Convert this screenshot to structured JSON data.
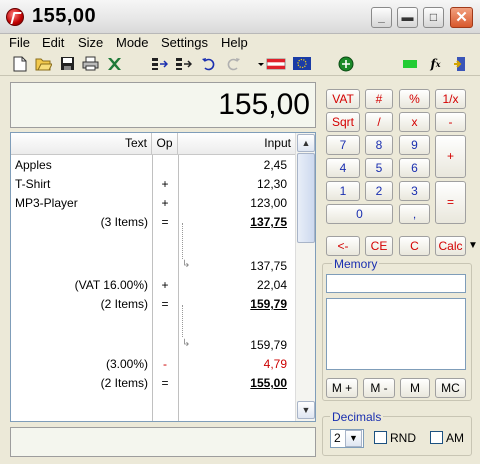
{
  "window": {
    "title": "155,00"
  },
  "menu": [
    "File",
    "Edit",
    "Size",
    "Mode",
    "Settings",
    "Help"
  ],
  "toolbar_icons": [
    "new-icon",
    "open-icon",
    "save-icon",
    "print-icon",
    "excel-icon",
    "list-icon",
    "export-icon",
    "undo-icon",
    "redo-icon",
    "flag-austria-icon",
    "flag-eu-icon",
    "globe-icon",
    "green-indicator-icon",
    "fx-icon",
    "exit-icon"
  ],
  "display": {
    "value": "155,00"
  },
  "tape": {
    "headers": {
      "text": "Text",
      "op": "Op",
      "input": "Input"
    },
    "rows": [
      {
        "text": "Apples",
        "op": "",
        "value": "2,45"
      },
      {
        "text": "T-Shirt",
        "op": "+",
        "value": "12,30"
      },
      {
        "text": "MP3-Player",
        "op": "+",
        "value": "123,00"
      },
      {
        "text": "(3 Items)",
        "op": "=",
        "value": "137,75"
      },
      {
        "text": "",
        "op": "",
        "value": ""
      },
      {
        "text": "",
        "op": "",
        "value": "137,75"
      },
      {
        "text": "(VAT 16.00%)",
        "op": "+",
        "value": "22,04"
      },
      {
        "text": "(2 Items)",
        "op": "=",
        "value": "159,79"
      },
      {
        "text": "",
        "op": "",
        "value": ""
      },
      {
        "text": "",
        "op": "",
        "value": "159,79"
      },
      {
        "text": "(3.00%)",
        "op": "-",
        "value": "4,79"
      },
      {
        "text": "(2 Items)",
        "op": "=",
        "value": "155,00"
      }
    ]
  },
  "keypad": {
    "vat": "VAT",
    "hash": "#",
    "percent": "%",
    "reciprocal": "1/x",
    "sqrt": "Sqrt",
    "divide": "/",
    "multiply": "x",
    "minus": "-",
    "n7": "7",
    "n8": "8",
    "n9": "9",
    "plus": "+",
    "n4": "4",
    "n5": "5",
    "n6": "6",
    "n1": "1",
    "n2": "2",
    "n3": "3",
    "equals": "=",
    "n0": "0",
    "comma": ",",
    "back": "<-",
    "ce": "CE",
    "c": "C",
    "calc": "Calc"
  },
  "memory": {
    "label": "Memory",
    "mplus": "M +",
    "mminus": "M -",
    "m": "M",
    "mc": "MC"
  },
  "decimals": {
    "label": "Decimals",
    "value": "2",
    "rnd": "RND",
    "am": "AM"
  },
  "colors": {
    "key_red": "#d40000",
    "key_blue": "#1a2fb0",
    "display_bg": "#f4f6ee"
  }
}
